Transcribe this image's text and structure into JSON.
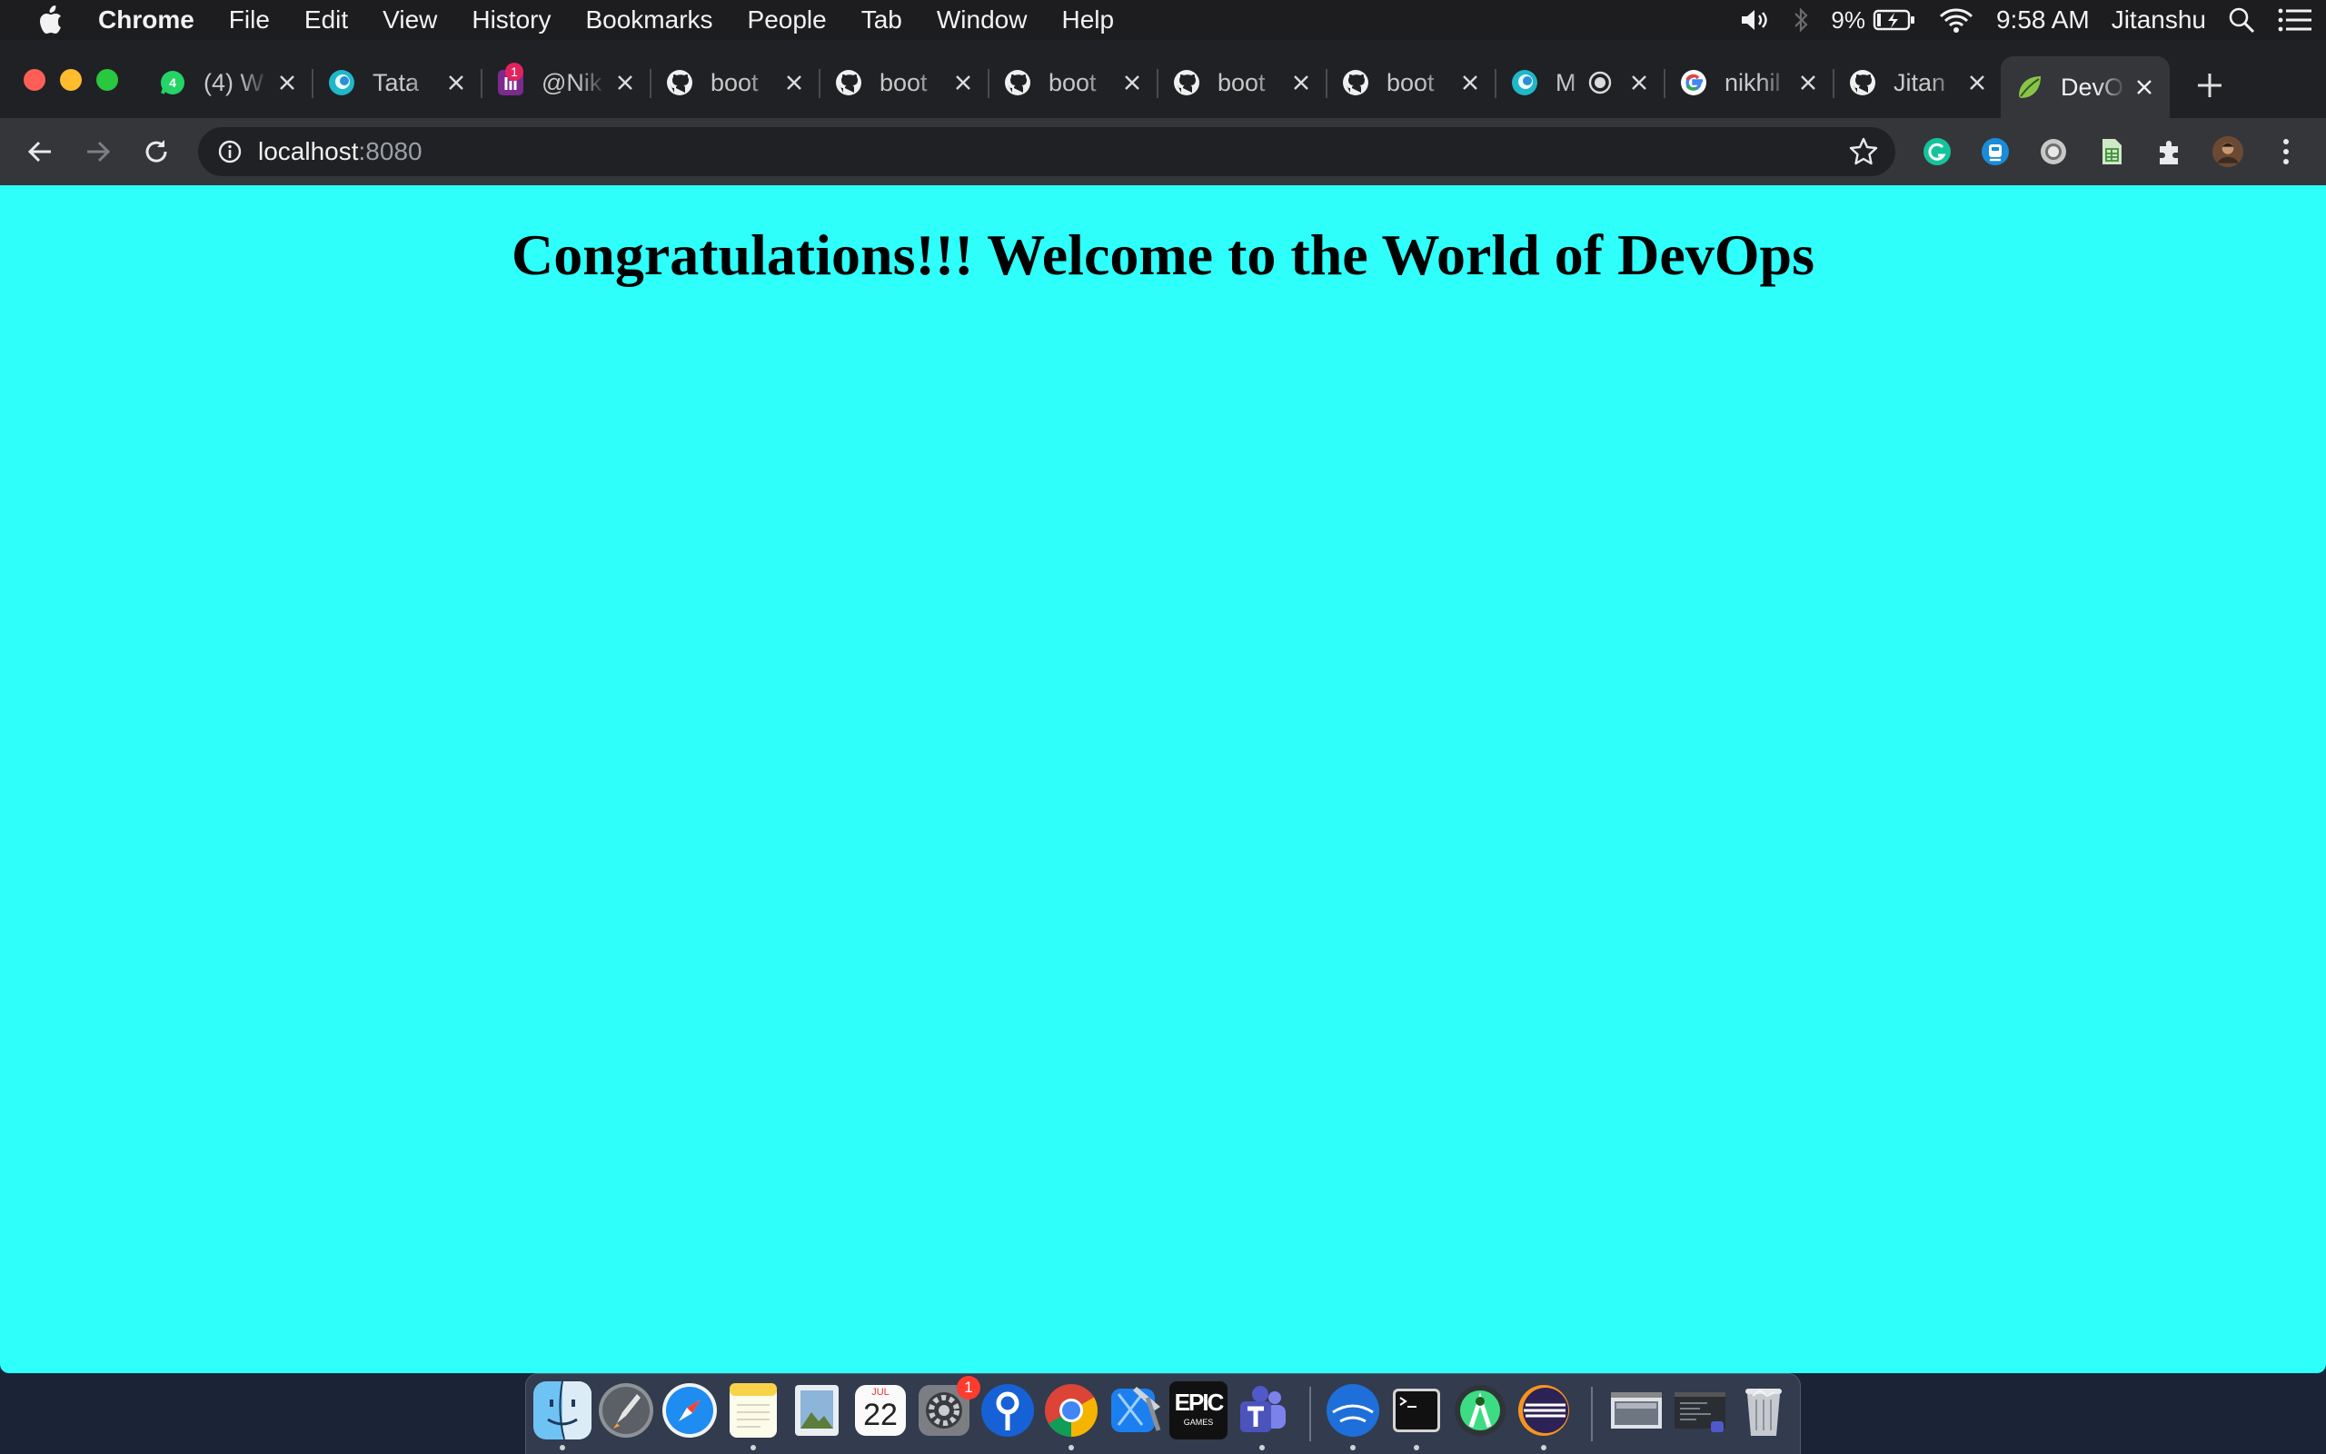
{
  "menubar": {
    "app_name": "Chrome",
    "items": [
      "File",
      "Edit",
      "View",
      "History",
      "Bookmarks",
      "People",
      "Tab",
      "Window",
      "Help"
    ],
    "battery": "9%",
    "clock": "9:58 AM",
    "user": "Jitanshu"
  },
  "tabs": [
    {
      "title": "(4) W",
      "icon": "whatsapp-icon",
      "active": false
    },
    {
      "title": "Tata",
      "icon": "edge-icon",
      "active": false
    },
    {
      "title": "@Nik",
      "icon": "app-notification-icon",
      "badge": "1",
      "active": false
    },
    {
      "title": "boot",
      "icon": "github-icon",
      "active": false
    },
    {
      "title": "boot",
      "icon": "github-icon",
      "active": false
    },
    {
      "title": "boot",
      "icon": "github-icon",
      "active": false
    },
    {
      "title": "boot",
      "icon": "github-icon",
      "active": false
    },
    {
      "title": "boot",
      "icon": "github-icon",
      "active": false
    },
    {
      "title": "M",
      "icon": "edge-icon",
      "active": false
    },
    {
      "title": "nikhil",
      "icon": "google-icon",
      "active": false
    },
    {
      "title": "Jitan",
      "icon": "github-icon",
      "active": false
    },
    {
      "title": "DevO",
      "icon": "spring-leaf-icon",
      "active": true
    }
  ],
  "omnibox": {
    "host": "localhost",
    "port": ":8080"
  },
  "page": {
    "heading": "Congratulations!!! Welcome to the World of DevOps",
    "background": "#2efffb"
  },
  "dock": {
    "calendar_month": "JUL",
    "calendar_day": "22",
    "settings_badge": "1",
    "epic_label_top": "EPIC",
    "epic_label_bottom": "GAMES"
  },
  "colors": {
    "tabstrip": "#202124",
    "toolbar": "#35363a",
    "page": "#2efffb"
  }
}
